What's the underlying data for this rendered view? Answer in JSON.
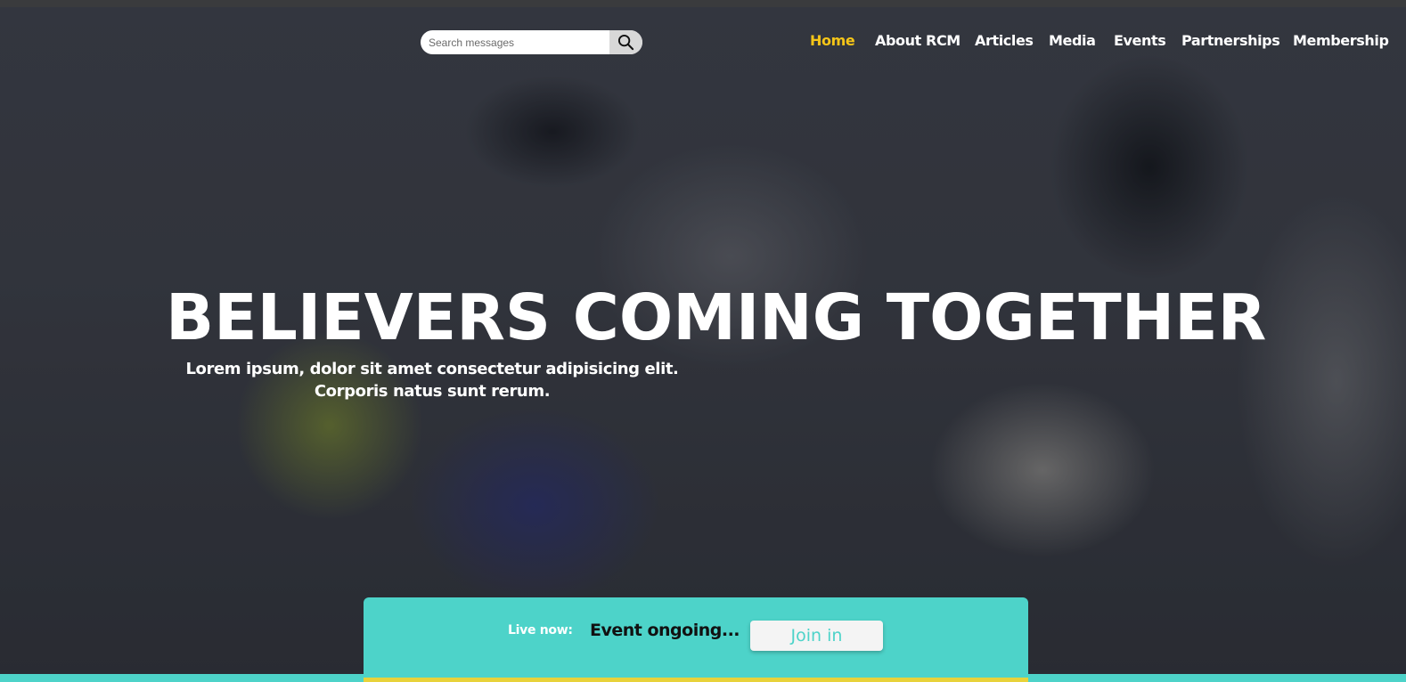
{
  "search": {
    "placeholder": "Search messages",
    "icon": "search-icon"
  },
  "nav": {
    "items": [
      {
        "label": "Home",
        "active": true
      },
      {
        "label": "About RCM",
        "active": false
      },
      {
        "label": "Articles",
        "active": false
      },
      {
        "label": "Media",
        "active": false
      },
      {
        "label": "Events",
        "active": false
      },
      {
        "label": "Partnerships",
        "active": false
      },
      {
        "label": "Membership",
        "active": false
      }
    ]
  },
  "hero": {
    "headline": "BELIEVERS COMING TOGETHER",
    "subtext_line1": "Lorem ipsum, dolor sit amet consectetur adipisicing elit.",
    "subtext_line2": "Corporis natus sunt rerum."
  },
  "live": {
    "label": "Live now:",
    "status": "Event ongoing...",
    "join_label": "Join in"
  },
  "colors": {
    "accent_teal": "#4dd3c9",
    "active_nav": "#f5c518",
    "accent_yellow": "#e8d23a"
  }
}
